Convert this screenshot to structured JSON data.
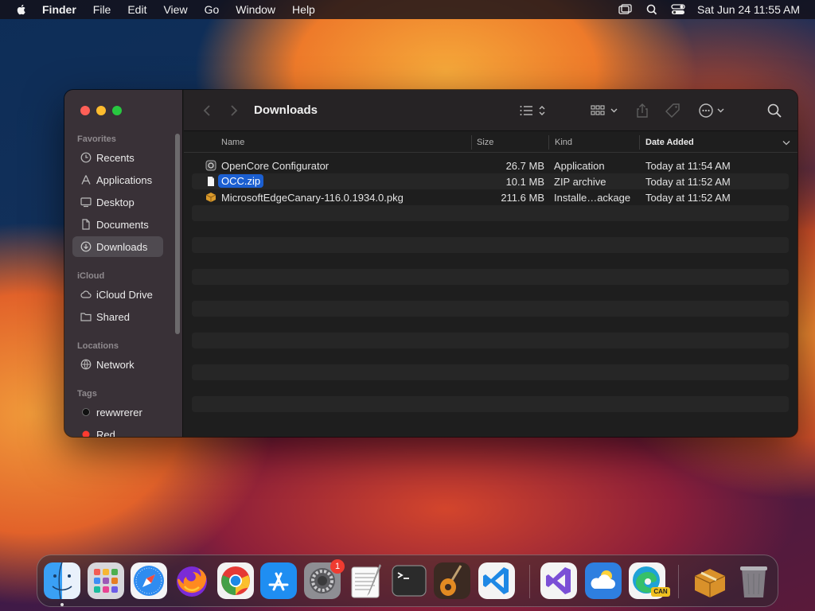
{
  "menubar": {
    "app_name": "Finder",
    "items": [
      "File",
      "Edit",
      "View",
      "Go",
      "Window",
      "Help"
    ],
    "clock": "Sat Jun 24  11:55 AM",
    "status_icons": [
      "screen-mirroring-icon",
      "spotlight-icon",
      "control-center-icon"
    ]
  },
  "finder": {
    "title": "Downloads",
    "sidebar": {
      "favorites_header": "Favorites",
      "favorites": [
        {
          "label": "Recents",
          "icon": "clock-icon"
        },
        {
          "label": "Applications",
          "icon": "applications-icon"
        },
        {
          "label": "Desktop",
          "icon": "desktop-icon"
        },
        {
          "label": "Documents",
          "icon": "document-icon"
        },
        {
          "label": "Downloads",
          "icon": "download-icon",
          "selected": true
        }
      ],
      "icloud_header": "iCloud",
      "icloud": [
        {
          "label": "iCloud Drive",
          "icon": "cloud-icon"
        },
        {
          "label": "Shared",
          "icon": "shared-folder-icon"
        }
      ],
      "locations_header": "Locations",
      "locations": [
        {
          "label": "Network",
          "icon": "network-icon"
        }
      ],
      "tags_header": "Tags",
      "tags": [
        {
          "label": "rewwrerer",
          "color": "#111111"
        },
        {
          "label": "Red",
          "color": "#ff3b30"
        }
      ]
    },
    "columns": {
      "name": "Name",
      "size": "Size",
      "kind": "Kind",
      "date_added": "Date Added"
    },
    "files": [
      {
        "name": "OpenCore Configurator",
        "size": "26.7 MB",
        "kind": "Application",
        "date": "Today at 11:54 AM",
        "icon": "app-icon"
      },
      {
        "name": "OCC.zip",
        "size": "10.1 MB",
        "kind": "ZIP archive",
        "date": "Today at 11:52 AM",
        "icon": "zip-file-icon",
        "selected": true
      },
      {
        "name": "MicrosoftEdgeCanary-116.0.1934.0.pkg",
        "size": "211.6 MB",
        "kind": "Installe…ackage",
        "date": "Today at 11:52 AM",
        "icon": "package-icon"
      }
    ]
  },
  "dock": {
    "apps": [
      "finder-icon",
      "launchpad-icon",
      "safari-icon",
      "firefox-icon",
      "chrome-icon",
      "app-store-icon",
      "system-settings-icon",
      "textedit-icon",
      "terminal-icon",
      "garageband-icon",
      "vscode-icon",
      "visual-studio-icon",
      "weather-icon",
      "edge-canary-icon",
      "installer-icon",
      "trash-icon"
    ],
    "settings_badge": "1",
    "edge_badge": "CAN"
  }
}
